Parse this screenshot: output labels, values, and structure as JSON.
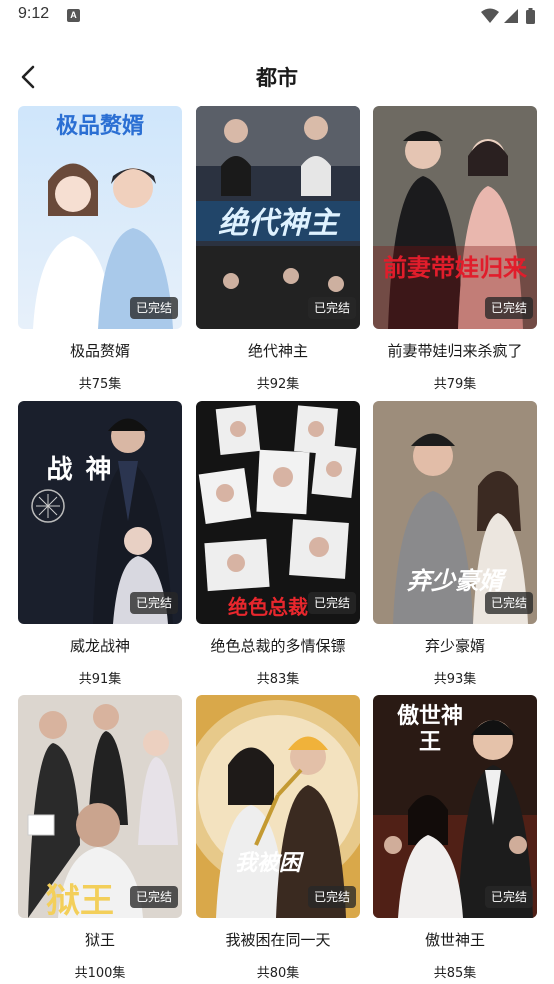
{
  "status_bar": {
    "time": "9:12",
    "notification_icon": "A"
  },
  "header": {
    "title": "都市",
    "back_icon": "chevron-left-icon"
  },
  "badge_colors": {
    "background": "#3a3a3a",
    "text": "#ffffff"
  },
  "dramas": [
    {
      "title": "极品赘婿",
      "count": "共75集",
      "status": "已完结",
      "cover_text": "极品赘婿"
    },
    {
      "title": "绝代神主",
      "count": "共92集",
      "status": "已完结",
      "cover_text": "绝代神主"
    },
    {
      "title": "前妻带娃归来杀疯了",
      "count": "共79集",
      "status": "已完结",
      "cover_text": "前妻带娃归来"
    },
    {
      "title": "威龙战神",
      "count": "共91集",
      "status": "已完结",
      "cover_text": "战 神"
    },
    {
      "title": "绝色总裁的多情保镖",
      "count": "共83集",
      "status": "已完结",
      "cover_text": "绝色总裁"
    },
    {
      "title": "弃少豪婿",
      "count": "共93集",
      "status": "已完结",
      "cover_text": "弃少豪婿"
    },
    {
      "title": "狱王",
      "count": "共100集",
      "status": "已完结",
      "cover_text": "狱王"
    },
    {
      "title": "我被困在同一天",
      "count": "共80集",
      "status": "已完结",
      "cover_text": "我被困"
    },
    {
      "title": "傲世神王",
      "count": "共85集",
      "status": "已完结",
      "cover_text": "傲世神王"
    }
  ]
}
